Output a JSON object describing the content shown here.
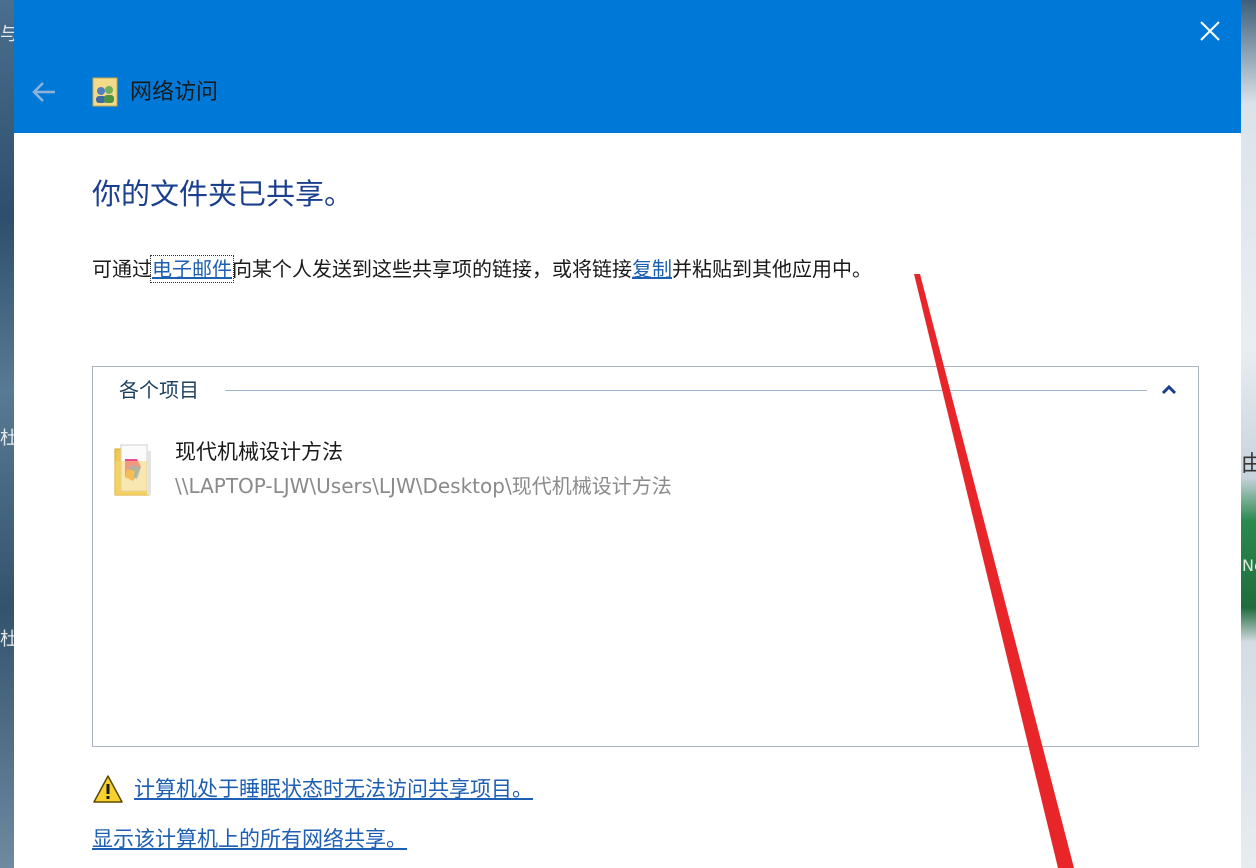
{
  "window": {
    "title": "网络访问"
  },
  "main": {
    "heading": "你的文件夹已共享。",
    "desc_part1": "可通过",
    "email_link": "电子邮件",
    "desc_part2": "向某个人发送到这些共享项的链接，或将链接",
    "copy_link": "复制",
    "desc_part3": "并粘贴到其他应用中。"
  },
  "items_group": {
    "label": "各个项目",
    "items": [
      {
        "name": "现代机械设计方法",
        "path": "\\\\LAPTOP-LJW\\Users\\LJW\\Desktop\\现代机械设计方法"
      }
    ]
  },
  "footer": {
    "warning_link": "计算机处于睡眠状态时无法访问共享项目。",
    "shares_link": "显示该计算机上的所有网络共享。"
  },
  "background": {
    "left_glyphs": [
      "与",
      "杜",
      "杜"
    ],
    "right_glyphs": [
      "由",
      "Ne"
    ]
  },
  "colors": {
    "titlebar": "#0078d7",
    "heading": "#1b3f8f",
    "link": "#1d5fb3",
    "annotation_arrow": "#e8262a"
  },
  "icons": {
    "close": "close-icon",
    "back": "back-arrow-icon",
    "app": "network-access-icon",
    "collapse": "chevron-up-icon",
    "folder": "folder-icon",
    "warning": "warning-icon"
  }
}
